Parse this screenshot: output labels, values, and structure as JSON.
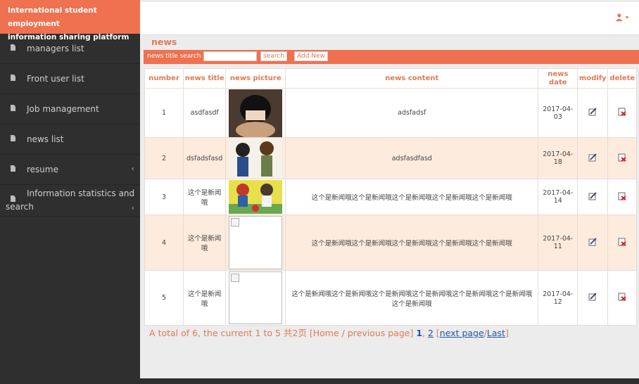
{
  "sidebar": {
    "brand": [
      "International student employment",
      "information sharing platform"
    ],
    "items": [
      {
        "label": "managers list"
      },
      {
        "label": "Front user list"
      },
      {
        "label": "Job management"
      },
      {
        "label": "news list"
      },
      {
        "label": "resume",
        "chevron": "‹"
      },
      {
        "label": "Information statistics and",
        "label2": "search",
        "chevron": "‹"
      }
    ]
  },
  "header": {
    "user_icon": "user-icon"
  },
  "page": {
    "title": "news"
  },
  "search": {
    "label": "news title search :",
    "value": "",
    "search_button": "search",
    "add_button": "Add New"
  },
  "table": {
    "columns": [
      "number",
      "news title",
      "news picture",
      "news content",
      "news date",
      "modify",
      "delete"
    ],
    "rows": [
      {
        "number": "1",
        "title": "asdfasdf",
        "picture": "dark-haired figure",
        "content": "adsfadsf",
        "date": "2017-04-03"
      },
      {
        "number": "2",
        "title": "dsfadsfasd",
        "picture": "two cartoon boys",
        "content": "adsfasdfasd",
        "date": "2017-04-18"
      },
      {
        "number": "3",
        "title": "这个是新闻哦",
        "picture": "cartoon soccer kids",
        "content": "这个是新闻哦这个是新闻哦这个是新闻哦这个是新闻哦这个是新闻哦",
        "date": "2017-04-14"
      },
      {
        "number": "4",
        "title": "这个是新闻哦",
        "picture": "broken image",
        "content": "这个是新闻哦这个是新闻哦这个是新闻哦这个是新闻哦这个是新闻哦",
        "date": "2017-04-11"
      },
      {
        "number": "5",
        "title": "这个是新闻哦",
        "picture": "broken image",
        "content": "这个是新闻哦这个是新闻哦这个是新闻哦这个是新闻哦这个是新闻哦这个是新闻哦这个是新闻哦",
        "date": "2017-04-12"
      }
    ]
  },
  "pager": {
    "summary": "A total of 6, the current 1 to 5 共2页",
    "home_prev": "[Home / previous page]",
    "page1": "1",
    "page2": "2",
    "next": "next page",
    "last": "Last"
  },
  "colors": {
    "accent": "#f0714f",
    "sidebar": "#2f2f2f",
    "alt_row": "#fdebdd",
    "header_text": "#e07a55"
  }
}
